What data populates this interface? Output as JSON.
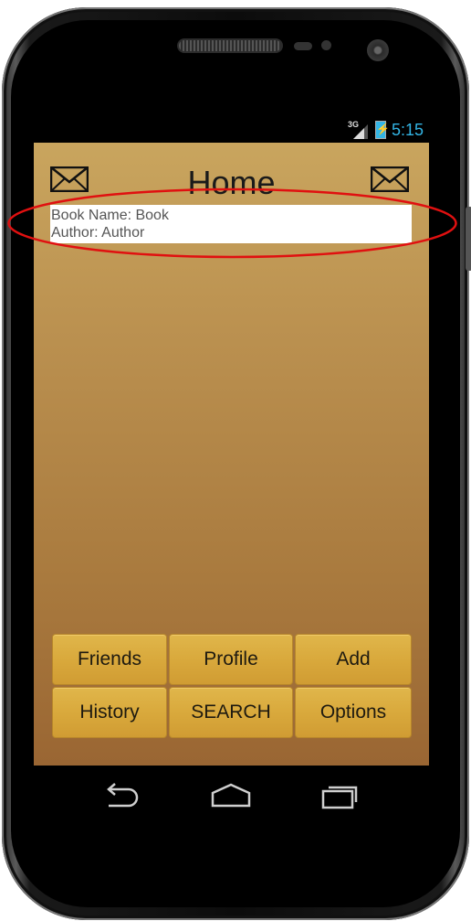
{
  "status_bar": {
    "network": "3G",
    "time": "5:15"
  },
  "header": {
    "title": "Home",
    "left_icon": "mail-icon",
    "right_icon": "mail-icon"
  },
  "book_card": {
    "book_name_line": "Book Name: Book",
    "author_line": "Author: Author"
  },
  "buttons": {
    "friends": "Friends",
    "profile": "Profile",
    "add": "Add",
    "history": "History",
    "search": "SEARCH",
    "options": "Options"
  },
  "nav_bar": {
    "back_icon": "back-icon",
    "home_icon": "home-icon",
    "recents_icon": "recents-icon"
  },
  "colors": {
    "accent": "#33b5e5",
    "highlight_oval": "#e01010",
    "button_gold": "#d9a93c"
  }
}
